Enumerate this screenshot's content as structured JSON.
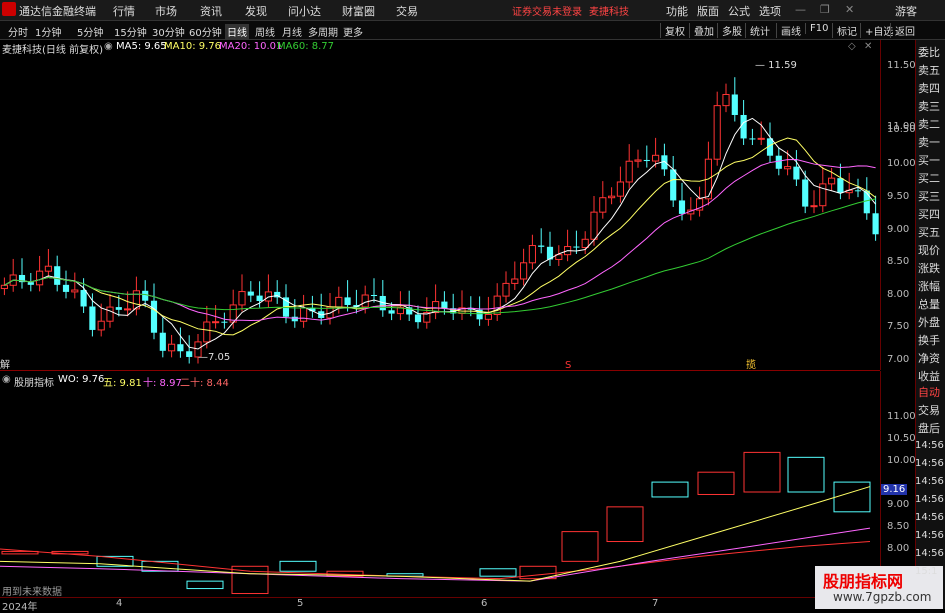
{
  "app": {
    "title": "通达信金融终端",
    "menus": [
      "行情",
      "市场",
      "资讯",
      "发现",
      "问小达",
      "财富圈",
      "交易"
    ],
    "warning": "证券交易未登录",
    "warn_stock": "麦捷科技",
    "right_menus": [
      "功能",
      "版面",
      "公式",
      "选项"
    ],
    "user": "游客"
  },
  "toolbar": {
    "timeframes": [
      "分时",
      "1分钟",
      "5分钟",
      "15分钟",
      "30分钟",
      "60分钟",
      "日线",
      "周线",
      "月线",
      "多周期",
      "更多"
    ],
    "active": "日线",
    "buttons": [
      "复权",
      "叠加",
      "多股",
      "统计",
      "画线",
      "F10",
      "标记",
      "+自选",
      "返回"
    ]
  },
  "main_info": {
    "stock": "麦捷科技(日线 前复权)",
    "ma5": "MA5: 9.65",
    "ma10": "MA10: 9.76",
    "ma20": "MA20: 10.01",
    "ma60": "MA60: 8.77"
  },
  "sub_info": {
    "name": "股朋指标",
    "wo": "WO: 9.76",
    "wu": "五: 9.81",
    "shi": "十: 8.97",
    "ershi": "二十: 8.44"
  },
  "price_axis": [
    "11.50",
    "11.00",
    "10.50",
    "10.00",
    "9.50",
    "9.00",
    "8.50",
    "8.00",
    "7.50",
    "7.05",
    "7.00"
  ],
  "annotations": {
    "high": "11.59",
    "low": "7.05",
    "left_mark": "解",
    "s_mark": "S",
    "b_mark": "揽"
  },
  "sub_axis": [
    "11.00",
    "10.50",
    "10.00",
    "9.16",
    "9.00",
    "8.50",
    "8.00"
  ],
  "sub_axis_times": [
    "14:56",
    "14:56",
    "14:56",
    "14:56",
    "14:56",
    "14:56",
    "14:56",
    "15:1"
  ],
  "right_panel": [
    "委比",
    "卖五",
    "卖四",
    "卖三",
    "卖二",
    "卖一",
    "买一",
    "买二",
    "买三",
    "买四",
    "买五",
    "现价",
    "涨跌",
    "涨幅",
    "总量",
    "外盘",
    "换手",
    "净资",
    "收益"
  ],
  "right_panel_lower": [
    "自动",
    "交易",
    "盘后"
  ],
  "date_axis": [
    "2024年",
    "4",
    "5",
    "6",
    "7"
  ],
  "footer_text": "用到未来数据",
  "watermark": {
    "line1": "股朋指标网",
    "line2": "www.7gpzb.com"
  },
  "colors": {
    "up": "#ff3333",
    "down": "#54ffff",
    "ma5": "#ffffff",
    "ma10": "#ffff66",
    "ma20": "#ff66ff",
    "ma60": "#33cc33"
  }
}
